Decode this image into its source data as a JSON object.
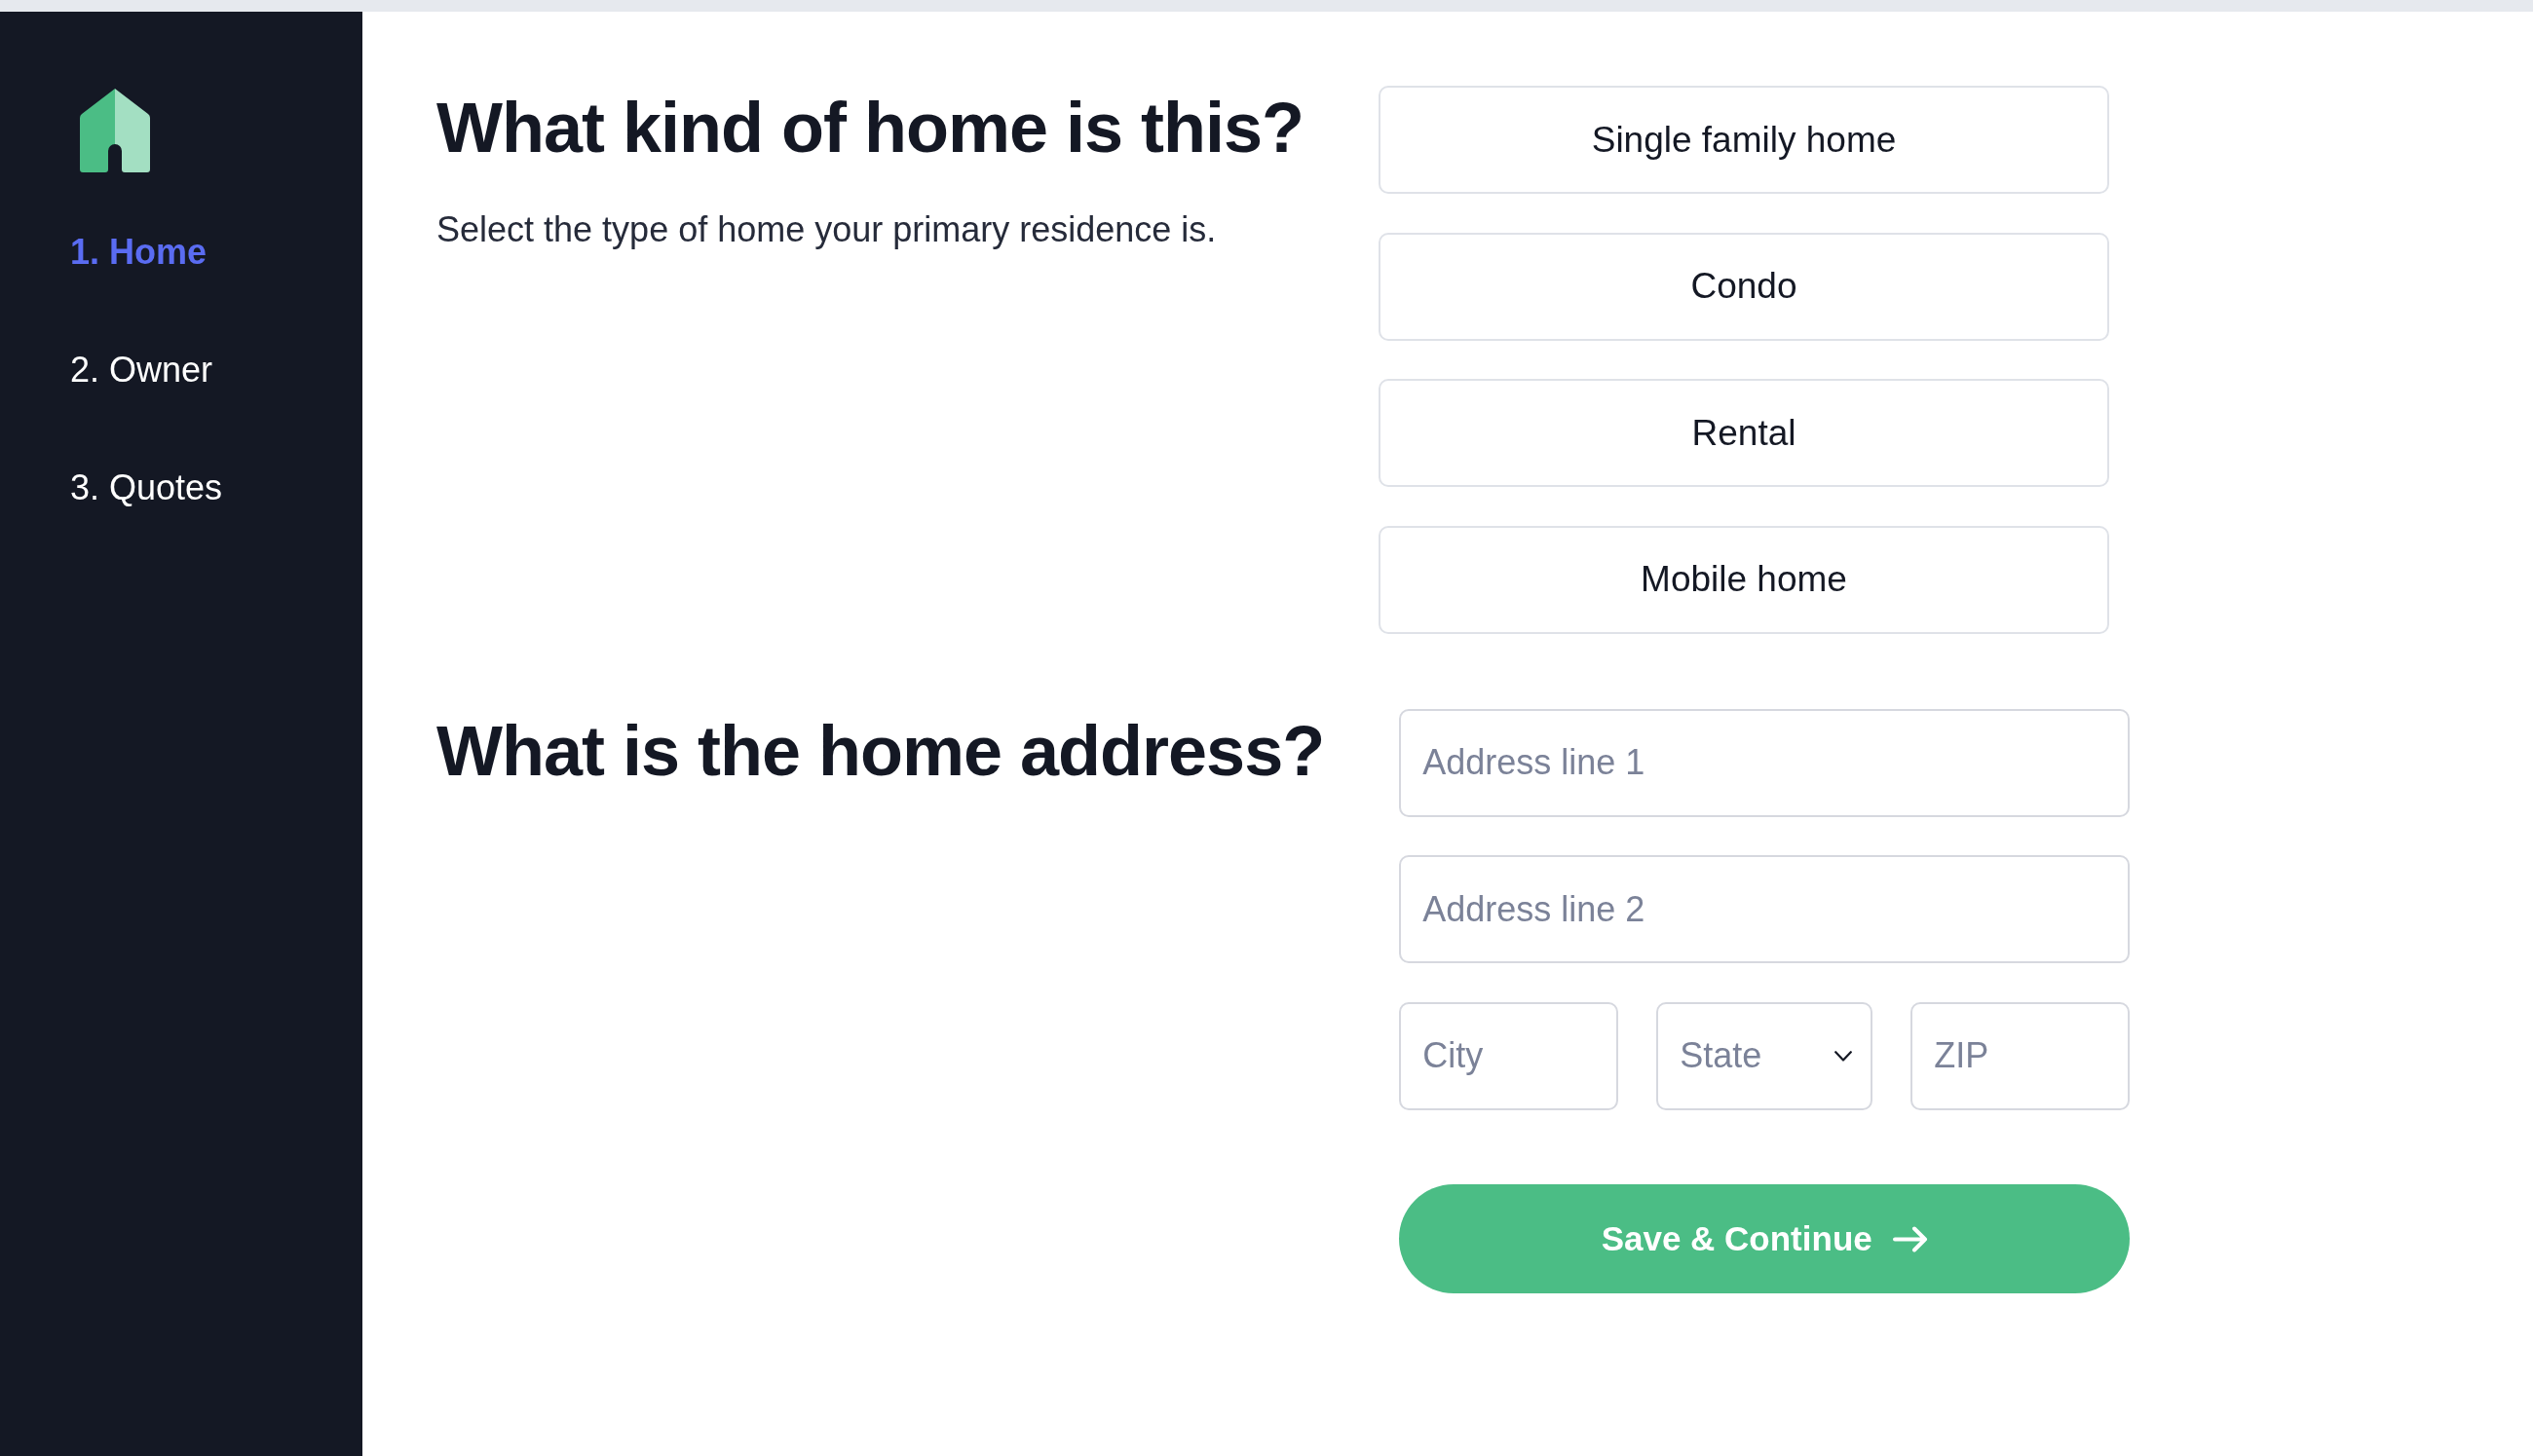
{
  "sidebar": {
    "steps": [
      {
        "label": "1. Home",
        "selected": true
      },
      {
        "label": "2. Owner",
        "selected": false
      },
      {
        "label": "3. Quotes",
        "selected": false
      }
    ]
  },
  "home_type": {
    "title": "What kind of home is this?",
    "description": "Select the type of home your primary residence is.",
    "options": [
      {
        "label": "Single family home",
        "selected": false
      },
      {
        "label": "Condo",
        "selected": false
      },
      {
        "label": "Rental",
        "selected": false
      },
      {
        "label": "Mobile home",
        "selected": false
      }
    ]
  },
  "address": {
    "title": "What is the home address?",
    "rows": [
      [
        {
          "kind": "text",
          "placeholder": "Address line 1"
        }
      ],
      [
        {
          "kind": "text",
          "placeholder": "Address line 2"
        }
      ],
      [
        {
          "kind": "text",
          "placeholder": "City"
        },
        {
          "kind": "select",
          "placeholder": "State"
        },
        {
          "kind": "text",
          "placeholder": "ZIP"
        }
      ]
    ],
    "submit": {
      "label": "Save & Continue"
    }
  }
}
